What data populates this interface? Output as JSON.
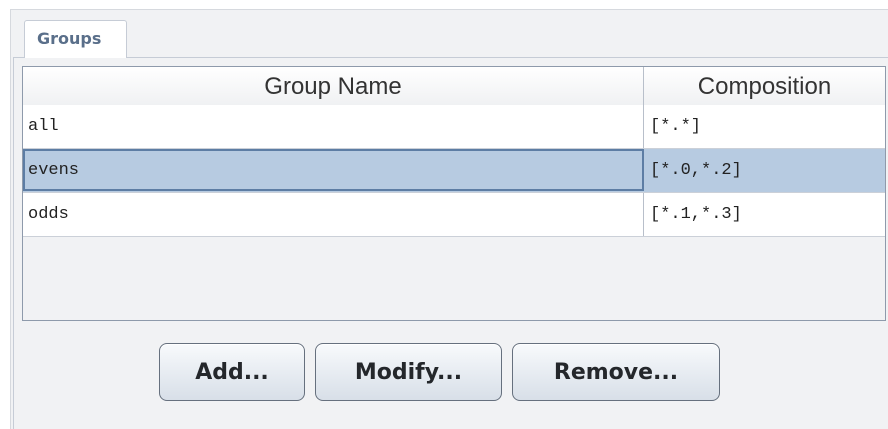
{
  "tab": {
    "label": "Groups"
  },
  "table": {
    "columns": [
      "Group Name",
      "Composition"
    ],
    "rows": [
      {
        "name": "all",
        "composition": "[*.*]"
      },
      {
        "name": "evens",
        "composition": "[*.0,*.2]"
      },
      {
        "name": "odds",
        "composition": "[*.1,*.3]"
      }
    ],
    "selected_row": 1
  },
  "buttons": {
    "add": "Add...",
    "modify": "Modify...",
    "remove": "Remove..."
  },
  "colors": {
    "selected_row": "#b7cbe1",
    "tab_text": "#5a6f8a"
  }
}
